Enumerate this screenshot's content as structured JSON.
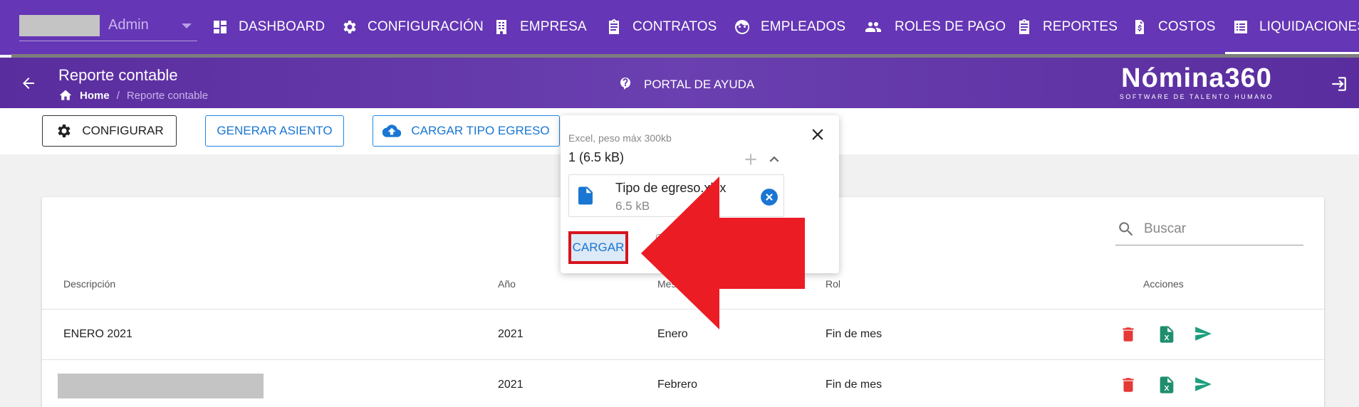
{
  "nav": {
    "user_name": "Admin",
    "items": [
      {
        "label": "DASHBOARD",
        "icon": "dashboard-icon"
      },
      {
        "label": "CONFIGURACIÓN",
        "icon": "gear-icon"
      },
      {
        "label": "EMPRESA",
        "icon": "building-icon"
      },
      {
        "label": "CONTRATOS",
        "icon": "clipboard-icon"
      },
      {
        "label": "EMPLEADOS",
        "icon": "face-icon"
      },
      {
        "label": "ROLES DE PAGO",
        "icon": "people-icon"
      },
      {
        "label": "REPORTES",
        "icon": "clipboard-icon"
      },
      {
        "label": "COSTOS",
        "icon": "invoice-icon"
      },
      {
        "label": "LIQUIDACIONES",
        "icon": "list-icon"
      }
    ],
    "active": "LIQUIDACIONES"
  },
  "subheader": {
    "title": "Reporte contable",
    "breadcrumb_home": "Home",
    "breadcrumb_sep": "/",
    "breadcrumb_current": "Reporte contable",
    "help_label": "PORTAL DE AYUDA",
    "brand_name": "Nómina360",
    "brand_tagline": "SOFTWARE DE TALENTO HUMANO"
  },
  "toolbar": {
    "configurar_label": "CONFIGURAR",
    "generar_asiento_label": "GENERAR ASIENTO",
    "cargar_tipo_label": "CARGAR TIPO EGRESO"
  },
  "table": {
    "search_placeholder": "Buscar",
    "headers": {
      "descripcion": "Descripción",
      "anio": "Año",
      "mes": "Mes",
      "rol": "Rol",
      "acciones": "Acciones"
    },
    "rows": [
      {
        "descripcion": "ENERO 2021",
        "anio": "2021",
        "mes": "Enero",
        "rol": "Fin de mes"
      },
      {
        "descripcion": "",
        "anio": "2021",
        "mes": "Febrero",
        "rol": "Fin de mes"
      }
    ]
  },
  "upload": {
    "hint": "Excel, peso máx 300kb",
    "count": "1 (6.5 kB)",
    "file_name": "Tipo de egreso.xlsx",
    "file_size": "6.5 kB",
    "cargar_label": "CARGAR"
  },
  "colors": {
    "nav_bg": "#6536b5",
    "accent_blue": "#1976d2",
    "highlight_red": "#ec1c24",
    "delete_red": "#e53935",
    "excel_green": "#1e8e6e"
  }
}
